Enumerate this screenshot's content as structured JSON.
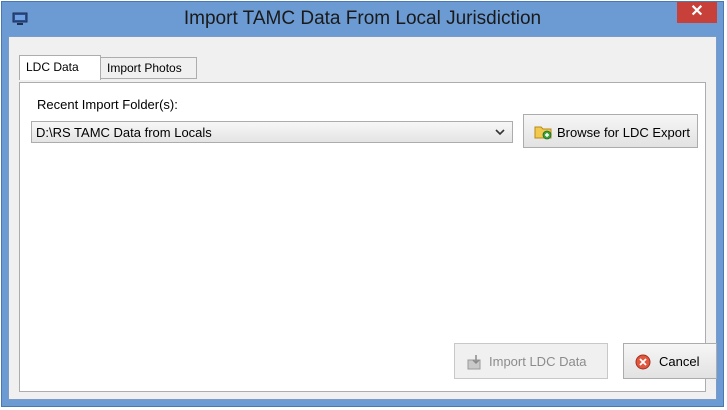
{
  "window": {
    "title": "Import TAMC Data From Local Jurisdiction",
    "close_symbol": "✕",
    "app_icon": "computer-icon"
  },
  "tabs": [
    {
      "label": "LDC Data",
      "active": true
    },
    {
      "label": "Import Photos",
      "active": false
    }
  ],
  "ldc_panel": {
    "recent_folder_label": "Recent Import Folder(s):",
    "recent_folder_value": "D:\\RS TAMC Data from Locals",
    "browse_button": {
      "label": "Browse for LDC Export",
      "icon": "folder-add-icon"
    }
  },
  "footer": {
    "import_button": {
      "label": "Import LDC Data",
      "icon": "import-icon",
      "enabled": false
    },
    "cancel_button": {
      "label": "Cancel",
      "icon": "cancel-icon"
    }
  },
  "colors": {
    "titlebar": "#6b9bd2",
    "close_button": "#c7413a",
    "client_bg": "#f0f0f0"
  }
}
